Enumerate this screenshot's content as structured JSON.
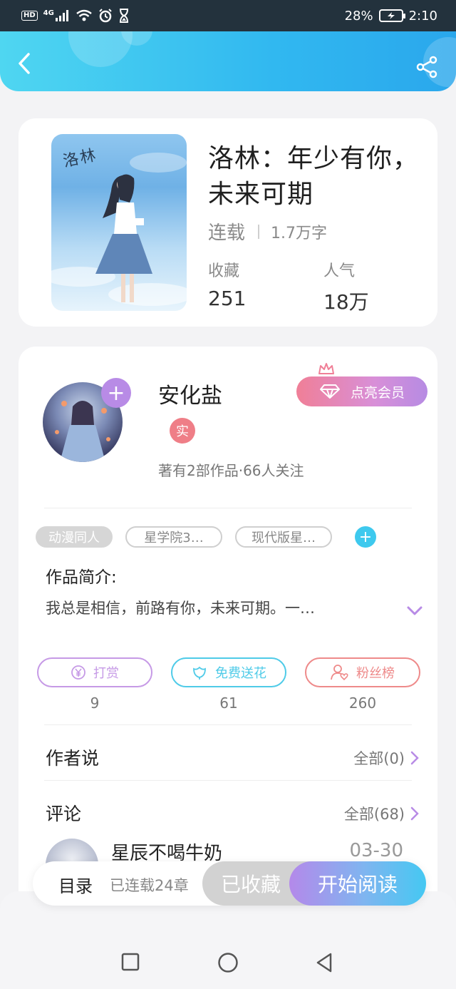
{
  "status_bar": {
    "hd_badge": "HD",
    "network": "4G",
    "battery": "28%",
    "time": "2:10"
  },
  "header": {
    "back_icon": "chevron-left-icon",
    "share_icon": "share-icon"
  },
  "book": {
    "cover_text": "洛林",
    "title": "洛林：年少有你，未来可期",
    "status": "连载",
    "word_count": "1.7万字",
    "favorites_label": "收藏",
    "favorites_value": "251",
    "popularity_label": "人气",
    "popularity_value": "18万"
  },
  "author": {
    "name": "安化盐",
    "verified_badge": "实",
    "meta": "著有2部作品·66人关注",
    "vip_button": "点亮会员"
  },
  "tags": [
    "动漫同人",
    "星学院3…",
    "现代版星…"
  ],
  "intro": {
    "title": "作品简介:",
    "text": "我总是相信，前路有你，未来可期。一…"
  },
  "actions": [
    {
      "label": "打赏",
      "count": "9",
      "color": "#c69ae6",
      "icon": "yen-coin-icon"
    },
    {
      "label": "免费送花",
      "count": "61",
      "color": "#4fcbe8",
      "icon": "flower-icon"
    },
    {
      "label": "粉丝榜",
      "count": "260",
      "color": "#ee8a8a",
      "icon": "fan-person-heart-icon"
    }
  ],
  "author_says": {
    "title": "作者说",
    "link": "全部(0)"
  },
  "comments": {
    "title": "评论",
    "link": "全部(68)",
    "first_user": "星辰不喝牛奶",
    "first_date": "03-30"
  },
  "bottom_bar": {
    "toc": "目录",
    "toc_count": "已连载24章",
    "favorited": "已收藏",
    "start_reading": "开始阅读"
  },
  "colors": {
    "header_gradient_start": "#4fd6f1",
    "header_gradient_end": "#2aa7ec",
    "accent_purple": "#b88be6",
    "vip_pink": "#f07f97"
  }
}
